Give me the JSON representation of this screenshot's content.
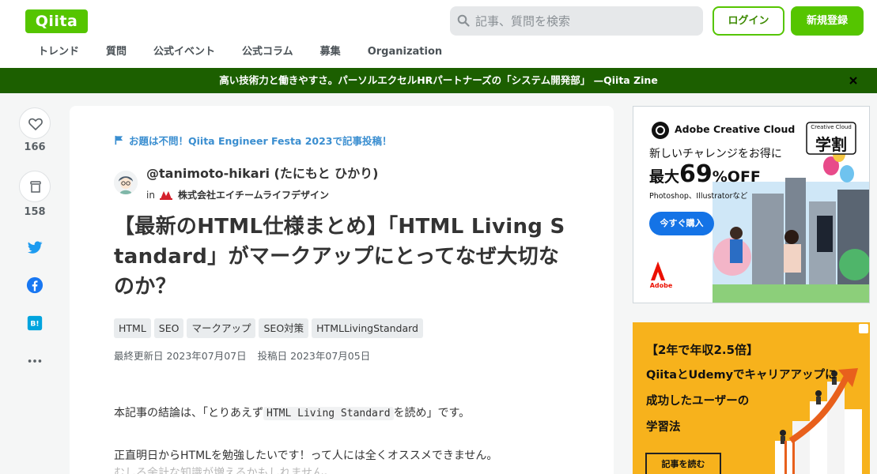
{
  "header": {
    "logo": "Qiita",
    "search_placeholder": "記事、質問を検索",
    "login": "ログイン",
    "signup": "新規登録",
    "nav": [
      "トレンド",
      "質問",
      "公式イベント",
      "公式コラム",
      "募集",
      "Organization"
    ]
  },
  "banner": {
    "text": "高い技術力と働きやすさ。パーソルエクセルHRパートナーズの「システム開発部」 —Qiita Zine"
  },
  "actions": {
    "likes": "166",
    "stocks": "158"
  },
  "article": {
    "event": "お題は不問！Qiita Engineer Festa 2023で記事投稿！",
    "author": "@tanimoto-hikari (たにもと ひかり)",
    "org_prefix": "in",
    "org_name": "株式会社エイチームライフデザイン",
    "title": "【最新のHTML仕様まとめ】「HTML Living Standard」がマークアップにとってなぜ大切なのか？",
    "tags": [
      "HTML",
      "SEO",
      "マークアップ",
      "SEO対策",
      "HTMLLivingStandard"
    ],
    "updated": "最終更新日 2023年07月07日",
    "posted": "投稿日 2023年07月05日",
    "p1_before": "本記事の結論は、「とりあえず",
    "p1_code": "HTML Living Standard",
    "p1_after": "を読め」です。",
    "p2": "正直明日からHTMLを勉強したいです！って人には全くオススメできません。",
    "p3": "むしろ余計な知識が増えるかもしれません。"
  },
  "ads": {
    "ad1": {
      "brand": "Adobe Creative Cloud",
      "badge_top": "Creative Cloud",
      "badge_main": "学割",
      "line1": "新しいチャレンジをお得に",
      "prefix": "最大",
      "percent": "69",
      "pct_sign": "%OFF",
      "apps": "Photoshop、Illustratorなど",
      "cta": "今すぐ購入",
      "adobe": "Adobe"
    },
    "ad2": {
      "line1": "【2年で年収2.5倍】",
      "line2": "QiitaとUdemyでキャリアアップに",
      "line3": "成功したユーザーの",
      "line4": "学習法",
      "cta": "記事を読む"
    }
  },
  "colors": {
    "brand": "#55c500",
    "banner": "#1c5f00",
    "link": "#3a8ed0"
  }
}
